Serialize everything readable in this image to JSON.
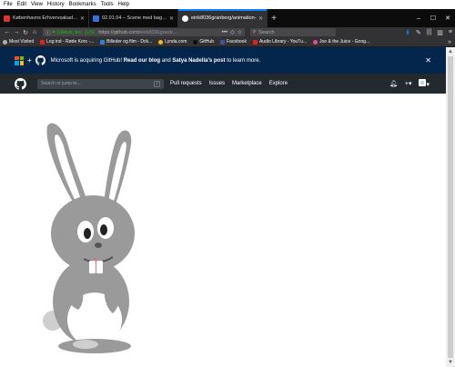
{
  "menu": [
    "File",
    "Edit",
    "View",
    "History",
    "Bookmarks",
    "Tools",
    "Help"
  ],
  "tabs": [
    {
      "title": "Københavns Erhvervsakademi",
      "favicon_color": "#e03030",
      "active": false
    },
    {
      "title": "02.01.04 – Scene med baggrund",
      "favicon_color": "#3b6fd8",
      "active": false
    },
    {
      "title": "eirik8036granberg/animation-",
      "favicon_color": "#24292e",
      "active": true
    }
  ],
  "nav": {
    "site_identity": "GitHub, Inc. (US)",
    "url_base": "https://github.com/",
    "url_path": "eirik8036granb…",
    "search_placeholder": "Search"
  },
  "bookmarks": [
    {
      "label": "Most Visited",
      "color": "#b1b1b3"
    },
    {
      "label": "Log ind - Røde Kors -...",
      "color": "#e02020"
    },
    {
      "label": "Billeder og film - Dck...",
      "color": "#2f7fd8"
    },
    {
      "label": "Lynda.com",
      "color": "#f0c020"
    },
    {
      "label": "GitHub",
      "color": "#24292e"
    },
    {
      "label": "Facebook",
      "color": "#3b5998"
    },
    {
      "label": "Audio Library - YouTu...",
      "color": "#e02020"
    },
    {
      "label": "Joe & the Juice - Goog...",
      "color": "#e0509a"
    }
  ],
  "banner": {
    "text_1": "Microsoft is acquiring GitHub!",
    "link_1": "Read our blog",
    "text_2": "and",
    "link_2": "Satya Nadella's post",
    "text_3": "to learn more."
  },
  "github_header": {
    "search_placeholder": "Search or jump to...",
    "search_shortcut": "/",
    "nav": [
      "Pull requests",
      "Issues",
      "Marketplace",
      "Explore"
    ]
  },
  "colors": {
    "banner_bg": "#05264c",
    "header_bg": "#24292e",
    "bunny_grey": "#9a9a9a",
    "bunny_light": "#cfcfcf",
    "tongue": "#f06a78"
  }
}
